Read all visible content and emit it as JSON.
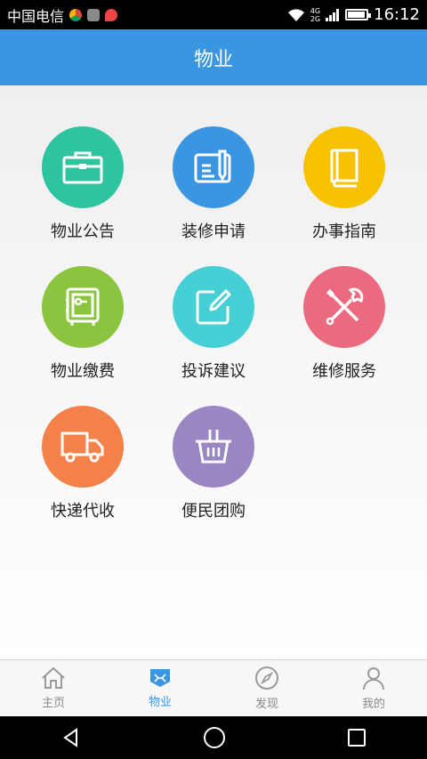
{
  "status_bar": {
    "carrier": "中国电信",
    "time": "16:12",
    "network_tags": [
      "4G",
      "2G"
    ],
    "battery_level": 0.85
  },
  "header": {
    "title": "物业"
  },
  "grid": {
    "items": [
      {
        "label": "物业公告",
        "icon": "briefcase-icon",
        "color": "#2ec4a0"
      },
      {
        "label": "装修申请",
        "icon": "form-pen-icon",
        "color": "#3a96e0"
      },
      {
        "label": "办事指南",
        "icon": "book-icon",
        "color": "#f7c200"
      },
      {
        "label": "物业缴费",
        "icon": "safe-icon",
        "color": "#8bc43f"
      },
      {
        "label": "投诉建议",
        "icon": "edit-icon",
        "color": "#47cfd6"
      },
      {
        "label": "维修服务",
        "icon": "tools-icon",
        "color": "#ec6a80"
      },
      {
        "label": "快递代收",
        "icon": "truck-icon",
        "color": "#f5814a"
      },
      {
        "label": "便民团购",
        "icon": "basket-icon",
        "color": "#9a86c2"
      }
    ]
  },
  "tabs": {
    "items": [
      {
        "label": "主页",
        "icon": "home-icon"
      },
      {
        "label": "物业",
        "icon": "property-icon"
      },
      {
        "label": "发现",
        "icon": "compass-icon"
      },
      {
        "label": "我的",
        "icon": "user-icon"
      }
    ],
    "active_index": 1,
    "active_color": "#3a96e0",
    "inactive_color": "#8a8a8a"
  },
  "system_nav": {
    "buttons": [
      "back-icon",
      "home-circle-icon",
      "recents-icon"
    ]
  }
}
